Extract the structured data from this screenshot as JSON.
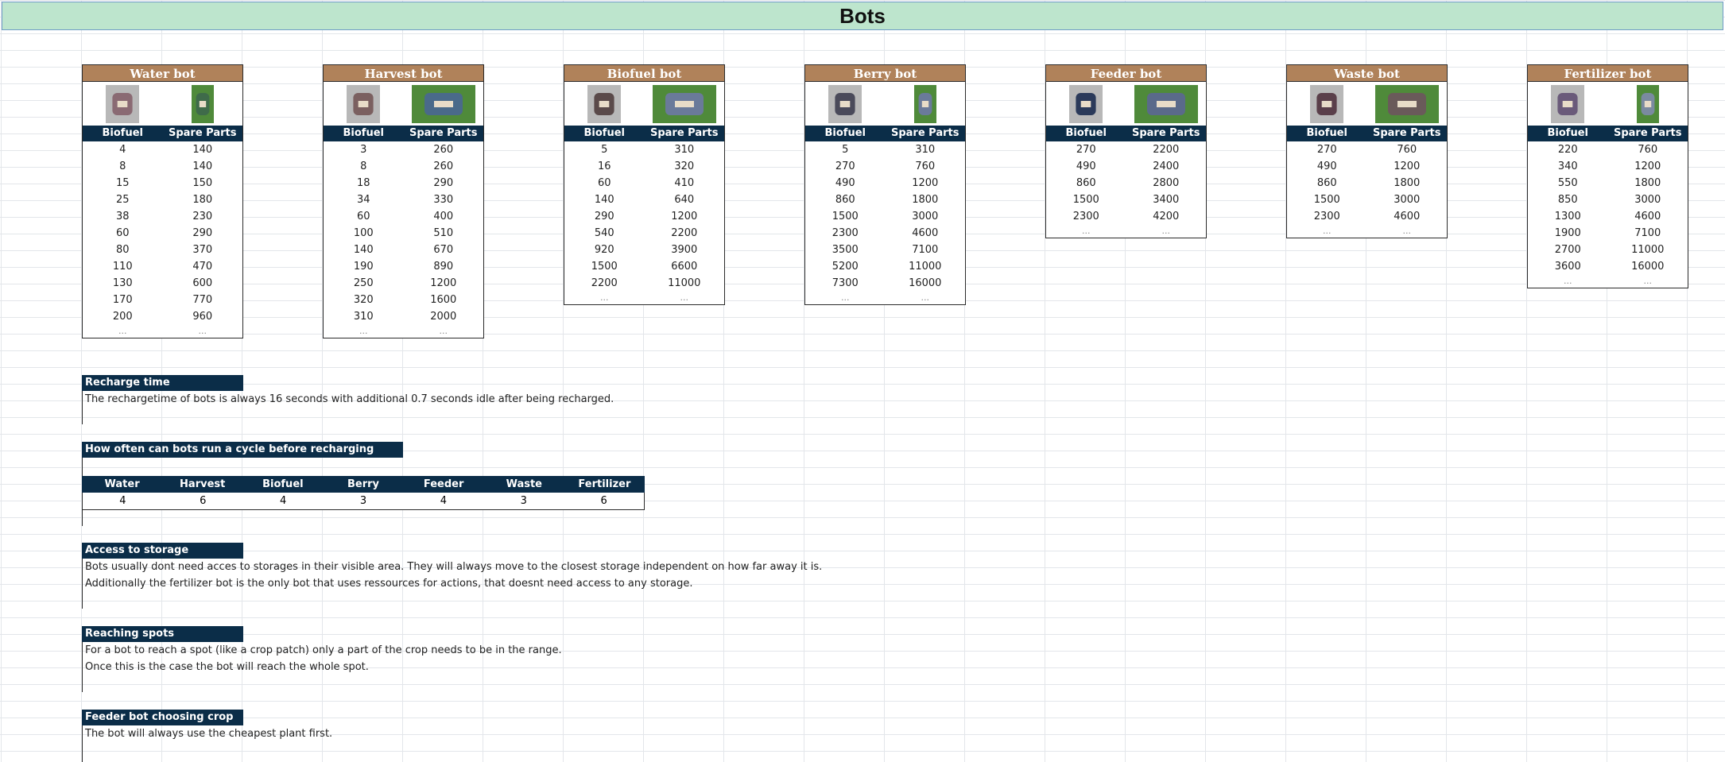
{
  "title": "Bots",
  "columns": {
    "biofuel": "Biofuel",
    "spare": "Spare Parts"
  },
  "ellipsis": "...",
  "bots": [
    {
      "name": "Water bot",
      "icons": [
        "water-bot-sprite",
        "water-bot-spare-parts-sprite"
      ],
      "rows": [
        [
          4,
          140
        ],
        [
          8,
          140
        ],
        [
          15,
          150
        ],
        [
          25,
          180
        ],
        [
          38,
          230
        ],
        [
          60,
          290
        ],
        [
          80,
          370
        ],
        [
          110,
          470
        ],
        [
          130,
          600
        ],
        [
          170,
          770
        ],
        [
          200,
          960
        ]
      ]
    },
    {
      "name": "Harvest bot",
      "icons": [
        "harvest-bot-sprite",
        "harvest-bot-spare-parts-sprite"
      ],
      "rows": [
        [
          3,
          260
        ],
        [
          8,
          260
        ],
        [
          18,
          290
        ],
        [
          34,
          330
        ],
        [
          60,
          400
        ],
        [
          100,
          510
        ],
        [
          140,
          670
        ],
        [
          190,
          890
        ],
        [
          250,
          1200
        ],
        [
          320,
          1600
        ],
        [
          310,
          2000
        ]
      ]
    },
    {
      "name": "Biofuel bot",
      "icons": [
        "biofuel-bot-sprite",
        "biofuel-bot-spare-parts-sprite"
      ],
      "rows": [
        [
          5,
          310
        ],
        [
          16,
          320
        ],
        [
          60,
          410
        ],
        [
          140,
          640
        ],
        [
          290,
          1200
        ],
        [
          540,
          2200
        ],
        [
          920,
          3900
        ],
        [
          1500,
          6600
        ],
        [
          2200,
          11000
        ]
      ]
    },
    {
      "name": "Berry bot",
      "icons": [
        "berry-bot-sprite",
        "berry-bot-spare-parts-sprite"
      ],
      "rows": [
        [
          5,
          310
        ],
        [
          270,
          760
        ],
        [
          490,
          1200
        ],
        [
          860,
          1800
        ],
        [
          1500,
          3000
        ],
        [
          2300,
          4600
        ],
        [
          3500,
          7100
        ],
        [
          5200,
          11000
        ],
        [
          7300,
          16000
        ]
      ]
    },
    {
      "name": "Feeder bot",
      "icons": [
        "feeder-bot-sprite",
        "feeder-bot-spare-parts-sprite"
      ],
      "rows": [
        [
          270,
          2200
        ],
        [
          490,
          2400
        ],
        [
          860,
          2800
        ],
        [
          1500,
          3400
        ],
        [
          2300,
          4200
        ]
      ]
    },
    {
      "name": "Waste bot",
      "icons": [
        "waste-bot-sprite",
        "waste-bot-spare-parts-sprite"
      ],
      "rows": [
        [
          270,
          760
        ],
        [
          490,
          1200
        ],
        [
          860,
          1800
        ],
        [
          1500,
          3000
        ],
        [
          2300,
          4600
        ]
      ]
    },
    {
      "name": "Fertilizer bot",
      "icons": [
        "fertilizer-bot-sprite",
        "fertilizer-bot-spare-parts-sprite"
      ],
      "rows": [
        [
          220,
          760
        ],
        [
          340,
          1200
        ],
        [
          550,
          1800
        ],
        [
          850,
          3000
        ],
        [
          1300,
          4600
        ],
        [
          1900,
          7100
        ],
        [
          2700,
          11000
        ],
        [
          3600,
          16000
        ]
      ]
    }
  ],
  "recharge": {
    "heading": "Recharge time",
    "lines": [
      "The rechargetime of bots is always 16 seconds with additional 0.7 seconds idle after being recharged."
    ]
  },
  "cycles": {
    "heading": "How often can bots run a cycle before recharging",
    "headers": [
      "Water",
      "Harvest",
      "Biofuel",
      "Berry",
      "Feeder",
      "Waste",
      "Fertilizer"
    ],
    "values": [
      "4",
      "6",
      "4",
      "3",
      "4",
      "3",
      "6"
    ]
  },
  "storage": {
    "heading": "Access to storage",
    "lines": [
      "Bots usually dont need acces to storages in their visible area. They will always move to the closest storage independent on how far away it is.",
      "Additionally the fertilizer bot is the only bot that uses ressources for actions, that doesnt need access to any storage."
    ]
  },
  "spots": {
    "heading": "Reaching spots",
    "lines": [
      "For a bot to reach a spot (like a crop patch) only a part of the crop needs to be in the range.",
      "Once this is the case the bot will reach the whole spot."
    ]
  },
  "feeder": {
    "heading": "Feeder bot choosing crop",
    "lines": [
      "The bot will always use the cheapest plant first."
    ]
  },
  "colors": {
    "header": "#0b2d48",
    "bot_title": "#b0825a",
    "title_bar": "#bde5cd",
    "sprite_bg": "#4f8a3a"
  }
}
